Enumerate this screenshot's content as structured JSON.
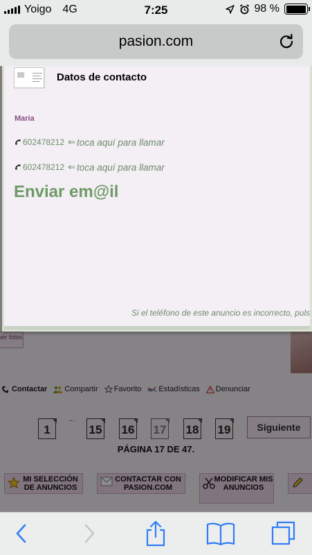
{
  "status_bar": {
    "carrier": "Yoigo",
    "network": "4G",
    "time": "7:25",
    "battery_percent_label": "98 %",
    "battery_level": 0.98
  },
  "browser": {
    "url": "pasion.com"
  },
  "modal": {
    "title": "Datos de contacto",
    "contact_name": "Maria",
    "phones": [
      {
        "number": "602478212",
        "hint": "toca aquí para llamar"
      },
      {
        "number": "602478212",
        "hint": "toca aquí para llamar"
      }
    ],
    "email_link": "Enviar em@il",
    "incorrect_note": "Si el teléfono de este anuncio es incorrecto, puls"
  },
  "background_page": {
    "ver_fotos": "ver fotos",
    "actions": {
      "contact": "Contactar",
      "share": "Compartir",
      "favorite": "Favorito",
      "stats": "Estadísticas",
      "report": "Denunciar"
    },
    "pagination": {
      "first": "1",
      "ellipsis": "...",
      "pages": [
        "15",
        "16",
        "17",
        "18",
        "19"
      ],
      "current": "17",
      "next_label": "Siguiente",
      "info": "PÁGINA 17 DE 47."
    },
    "menu": {
      "my_selection": "MI SELECCIÓN DE ANUNCIOS",
      "contact_pasion": "CONTACTAR CON PASION.COM",
      "modify_ads": "MODIFICAR MIS ANUNCIOS"
    }
  },
  "colors": {
    "link_green": "#6f9a67",
    "name_purple": "#8d4e86",
    "ios_blue": "#2f7cf6"
  },
  "icons": {
    "phone": "phone-icon",
    "back": "chevron-left-icon",
    "forward": "chevron-right-icon",
    "share": "share-icon",
    "bookmarks": "book-icon",
    "tabs": "tabs-icon"
  }
}
